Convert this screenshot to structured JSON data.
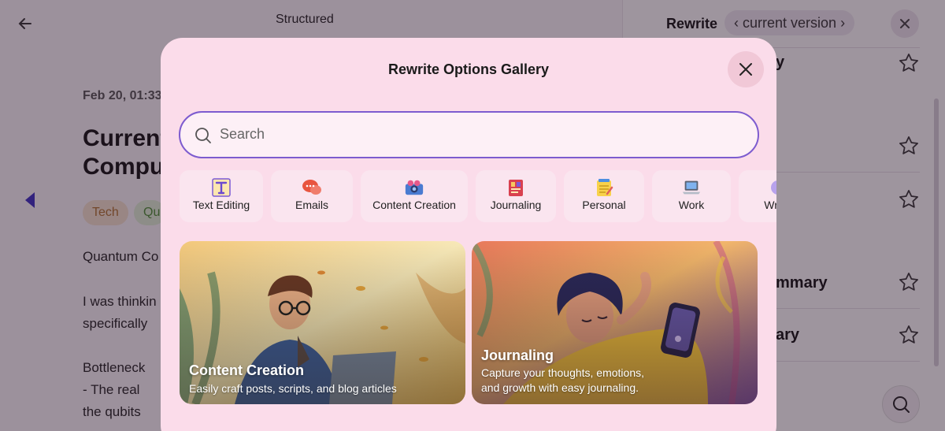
{
  "background": {
    "header_tab": "Structured",
    "date": "Feb 20, 01:33",
    "title_lines": [
      "Current",
      "Compu"
    ],
    "tags": [
      "Tech",
      "Qu"
    ],
    "body_lines": [
      "Quantum Co",
      "I was thinkin",
      "specifically",
      "Bottleneck",
      "- The real",
      "the qubits"
    ],
    "rewrite_panel": {
      "title": "Rewrite",
      "version": "current version",
      "items": [
        "y",
        "mmary",
        "ary"
      ]
    }
  },
  "modal": {
    "title": "Rewrite Options Gallery",
    "search_placeholder": "Search",
    "search_value": "",
    "categories": [
      {
        "label": "Text Editing",
        "icon": "text-edit-icon"
      },
      {
        "label": "Emails",
        "icon": "chat-bubbles-icon"
      },
      {
        "label": "Content Creation",
        "icon": "camera-icon"
      },
      {
        "label": "Journaling",
        "icon": "notebook-icon"
      },
      {
        "label": "Personal",
        "icon": "notepad-icon"
      },
      {
        "label": "Work",
        "icon": "laptop-icon"
      },
      {
        "label": "Writin",
        "icon": "writing-icon"
      }
    ],
    "cards": [
      {
        "title": "Content Creation",
        "description": "Easily craft posts, scripts, and blog articles"
      },
      {
        "title": "Journaling",
        "description_lines": [
          "Capture your thoughts, emotions,",
          "and growth with easy journaling."
        ]
      }
    ]
  },
  "colors": {
    "modal_bg": "#fbdcea",
    "search_border": "#7d5ccf",
    "category_bg": "#fae5ef",
    "accent_purple": "#3b2fc4"
  }
}
